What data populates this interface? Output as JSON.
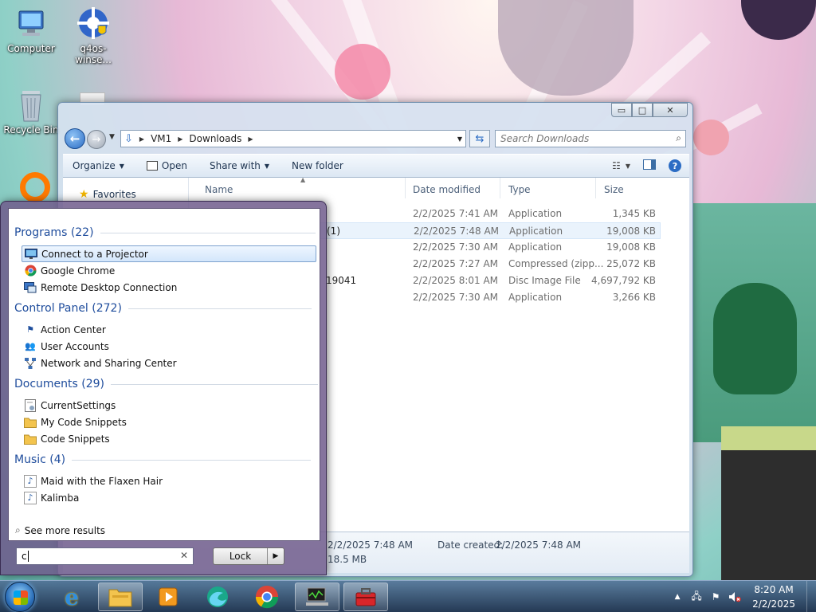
{
  "desktop": {
    "icons": [
      {
        "label": "Computer"
      },
      {
        "label": "q4os-winse..."
      },
      {
        "label": "Recycle Bin"
      }
    ]
  },
  "explorer": {
    "window_buttons": {
      "minimize": "▭",
      "maximize": "□",
      "close": "✕"
    },
    "breadcrumb": [
      "VM1",
      "Downloads"
    ],
    "search_placeholder": "Search Downloads",
    "toolbar": {
      "organize": "Organize",
      "open": "Open",
      "share_with": "Share with",
      "new_folder": "New folder"
    },
    "nav": {
      "favorites": "Favorites"
    },
    "columns": {
      "name": "Name",
      "date": "Date modified",
      "type": "Type",
      "size": "Size"
    },
    "files": [
      {
        "name": "",
        "date": "2/2/2025 7:41 AM",
        "type": "Application",
        "size": "1,345 KB"
      },
      {
        "name": "(1)",
        "date": "2/2/2025 7:48 AM",
        "type": "Application",
        "size": "19,008 KB"
      },
      {
        "name": "",
        "date": "2/2/2025 7:30 AM",
        "type": "Application",
        "size": "19,008 KB"
      },
      {
        "name": "",
        "date": "2/2/2025 7:27 AM",
        "type": "Compressed (zipp...",
        "size": "25,072 KB"
      },
      {
        "name": "19041",
        "date": "2/2/2025 8:01 AM",
        "type": "Disc Image File",
        "size": "4,697,792 KB"
      },
      {
        "name": "",
        "date": "2/2/2025 7:30 AM",
        "type": "Application",
        "size": "3,266 KB"
      }
    ],
    "details": {
      "modified_value": "2/2/2025 7:48 AM",
      "created_label": "Date created:",
      "created_value": "2/2/2025 7:48 AM",
      "size_value": "18.5 MB"
    }
  },
  "start_menu": {
    "categories": {
      "programs": "Programs (22)",
      "control_panel": "Control Panel (272)",
      "documents": "Documents (29)",
      "music": "Music (4)"
    },
    "programs": [
      "Connect to a Projector",
      "Google Chrome",
      "Remote Desktop Connection"
    ],
    "control_panel": [
      "Action Center",
      "User Accounts",
      "Network and Sharing Center"
    ],
    "documents": [
      "CurrentSettings",
      "My Code Snippets",
      "Code Snippets"
    ],
    "music": [
      "Maid with the Flaxen Hair",
      "Kalimba"
    ],
    "see_more": "See more results",
    "search_value": "c",
    "lock_label": "Lock"
  },
  "taskbar": {
    "time": "8:20 AM",
    "date": "2/2/2025"
  }
}
